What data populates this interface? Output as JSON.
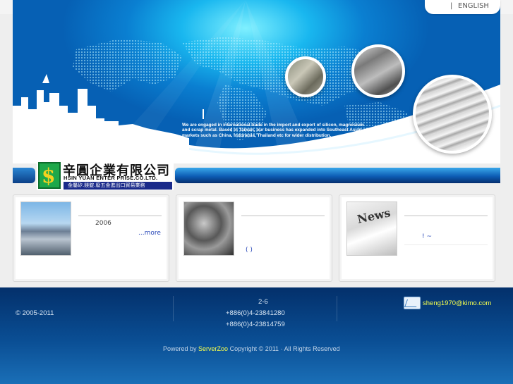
{
  "header": {
    "lang_separator": "|",
    "lang_english": "ENGLISH"
  },
  "banner": {
    "cursor_mark": "|",
    "intro": "We are engaged in international trade in the import and export of silicon, magnesium and scrap metal. Based in Taiwan, our business has expanded into Southeast Asian markets such as China, Indonesia, Thailand etc for wider distribution."
  },
  "logo": {
    "chinese_name": "辛圓企業有限公司",
    "english_name": "HSIN YUAN ENTER PRISE.CO.LTD.",
    "subtitle": "金屬矽.鎂錠.廢五金進出口貿易業務",
    "mark": "$"
  },
  "boxes": [
    {
      "year": "2006",
      "more": "...more"
    },
    {
      "text": "( )"
    },
    {
      "text": "! ~",
      "thumb_label": "News"
    }
  ],
  "footer": {
    "copyright": "© 2005-2011",
    "address": "2-6",
    "tel": "+886(0)4-23841280",
    "fax": "+886(0)4-23814759",
    "email": "sheng1970@kimo.com",
    "powered_prefix": "Powered by ",
    "powered_brand": "ServerZoo",
    "powered_suffix": " Copyright © 2011 · All Rights Reserved"
  },
  "colors": {
    "banner_blue": "#0a7fd1",
    "footer_blue": "#0a4e94",
    "link_blue": "#2a49b8",
    "highlight_yellow": "#f6ff4d"
  }
}
